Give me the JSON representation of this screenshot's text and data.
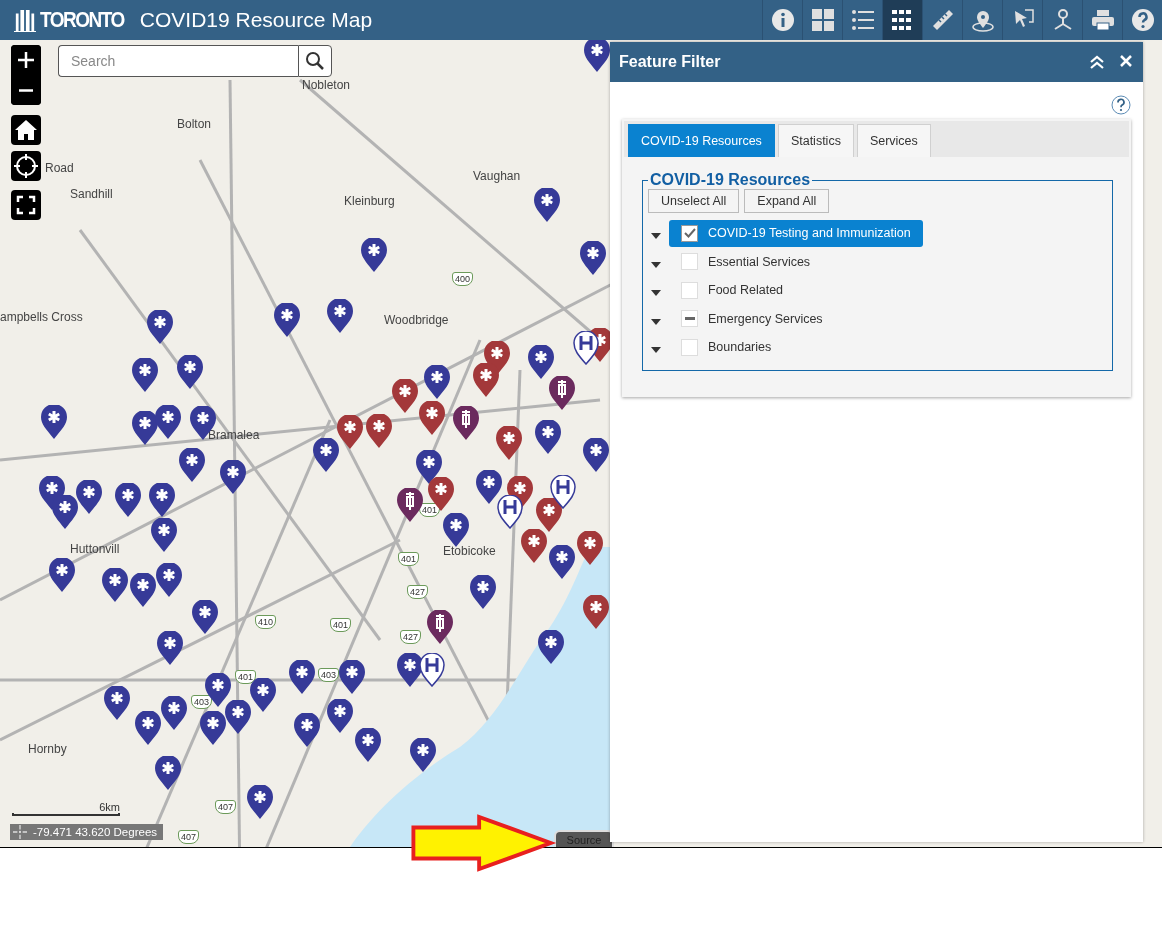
{
  "header": {
    "logo": "TORONTO",
    "title": "COVID19 Resource Map",
    "tools": [
      {
        "kind": "info",
        "selected": false
      },
      {
        "kind": "grid",
        "selected": false
      },
      {
        "kind": "list",
        "selected": false
      },
      {
        "kind": "filter",
        "selected": true
      },
      {
        "kind": "ruler",
        "selected": false
      },
      {
        "kind": "location",
        "selected": false
      },
      {
        "kind": "select",
        "selected": false
      },
      {
        "kind": "network",
        "selected": false
      },
      {
        "kind": "print",
        "selected": false
      },
      {
        "kind": "help",
        "selected": false
      }
    ]
  },
  "search": {
    "placeholder": "Search"
  },
  "map": {
    "labels": [
      "Nobleton",
      "Bolton",
      "Road",
      "Sandhill",
      "Vaughan",
      "Kleinburg",
      "ampbells Cross",
      "Woodbridge",
      "Bramalea",
      "Etobicoke",
      "Huttonvill",
      "Hornby"
    ],
    "highway_shields": [
      "400",
      "401",
      "401",
      "427",
      "410",
      "401",
      "427",
      "401",
      "403",
      "403",
      "407",
      "407"
    ],
    "scale": "6km",
    "coordinates": "-79.471 43.620 Degrees",
    "source_tab": "Source"
  },
  "panel": {
    "title": "Feature Filter",
    "tabs": [
      {
        "label": "COVID-19 Resources",
        "selected": true
      },
      {
        "label": "Statistics",
        "selected": false
      },
      {
        "label": "Services",
        "selected": false
      }
    ],
    "group": {
      "legend": "COVID-19 Resources",
      "buttons": [
        "Unselect All",
        "Expand All"
      ],
      "layers": [
        {
          "label": "COVID-19 Testing and Immunization",
          "checked": true,
          "partial": false,
          "selected": true
        },
        {
          "label": "Essential Services",
          "checked": false,
          "partial": false,
          "selected": false
        },
        {
          "label": "Food Related",
          "checked": false,
          "partial": false,
          "selected": false
        },
        {
          "label": "Emergency Services",
          "checked": false,
          "partial": true,
          "selected": false
        },
        {
          "label": "Boundaries",
          "checked": false,
          "partial": false,
          "selected": false
        }
      ]
    }
  }
}
